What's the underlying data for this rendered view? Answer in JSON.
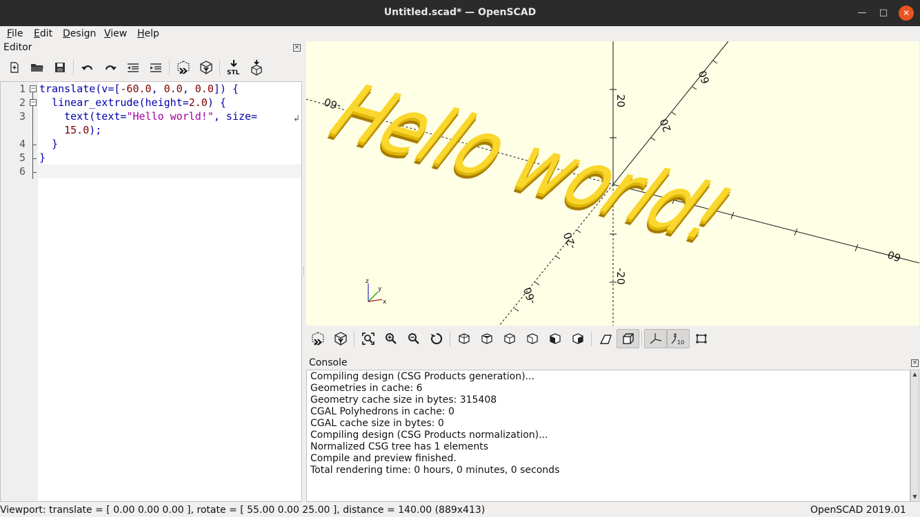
{
  "window": {
    "title": "Untitled.scad* — OpenSCAD"
  },
  "menu": {
    "items": [
      {
        "label": "File",
        "mnemonic": "F",
        "rest": "ile"
      },
      {
        "label": "Edit",
        "mnemonic": "E",
        "rest": "dit"
      },
      {
        "label": "Design",
        "mnemonic": "D",
        "rest": "esign"
      },
      {
        "label": "View",
        "mnemonic": "V",
        "rest": "iew"
      },
      {
        "label": "Help",
        "mnemonic": "H",
        "rest": "elp"
      }
    ]
  },
  "editor": {
    "title": "Editor",
    "toolbar": [
      "new-file-icon",
      "open-file-icon",
      "save-icon",
      "undo-icon",
      "redo-icon",
      "unindent-icon",
      "indent-icon",
      "preview-icon",
      "render-icon",
      "export-stl-icon",
      "send-to-print-icon"
    ],
    "lines": [
      {
        "num": "1",
        "parts": [
          {
            "t": "translate(v=[",
            "c": "kw"
          },
          {
            "t": "-60.0",
            "c": "num"
          },
          {
            "t": ", ",
            "c": "kw"
          },
          {
            "t": "0.0",
            "c": "num"
          },
          {
            "t": ", ",
            "c": "kw"
          },
          {
            "t": "0.0",
            "c": "num"
          },
          {
            "t": "]) {",
            "c": "kw"
          }
        ]
      },
      {
        "num": "2",
        "parts": [
          {
            "t": "  linear_extrude(height=",
            "c": "kw"
          },
          {
            "t": "2.0",
            "c": "num"
          },
          {
            "t": ") {",
            "c": "kw"
          }
        ]
      },
      {
        "num": "3",
        "parts": [
          {
            "t": "    text(text=",
            "c": "kw"
          },
          {
            "t": "\"Hello world!\"",
            "c": "str"
          },
          {
            "t": ", size=",
            "c": "kw"
          }
        ]
      },
      {
        "num": "",
        "parts": [
          {
            "t": "    ",
            "c": "kw"
          },
          {
            "t": "15.0",
            "c": "num"
          },
          {
            "t": ");",
            "c": "kw"
          }
        ]
      },
      {
        "num": "4",
        "parts": [
          {
            "t": "  }",
            "c": "kw"
          }
        ]
      },
      {
        "num": "5",
        "parts": [
          {
            "t": "}",
            "c": "kw"
          }
        ]
      },
      {
        "num": "6",
        "parts": []
      }
    ]
  },
  "viewport": {
    "text": "Hello world!",
    "axis_labels": {
      "x_neg": "-60",
      "x_pos": "60",
      "y_top": "60",
      "y_mid": "20",
      "z_pos": "20",
      "z_neg": "-20",
      "y_neg_a": "-20",
      "y_neg_b": "-60"
    },
    "axes_indicator": {
      "x": "x",
      "y": "y",
      "z": "z"
    },
    "colors": {
      "background": "#ffffe5",
      "model_top": "#f9d72c",
      "model_side": "#e0b50a",
      "model_dark": "#a77d00"
    },
    "toolbar": [
      "preview-icon",
      "render-icon",
      "view-all-icon",
      "zoom-in-icon",
      "zoom-out-icon",
      "reset-view-icon",
      "view-right-icon",
      "view-top-icon",
      "view-bottom-icon",
      "view-left-icon",
      "view-front-icon",
      "view-back-icon",
      "perspective-icon",
      "orthogonal-icon",
      "show-axes-icon",
      "show-scale-markers-icon",
      "show-edges-icon"
    ]
  },
  "console": {
    "title": "Console",
    "lines": [
      "Compiling design (CSG Products generation)...",
      "Geometries in cache: 6",
      "Geometry cache size in bytes: 315408",
      "CGAL Polyhedrons in cache: 0",
      "CGAL cache size in bytes: 0",
      "Compiling design (CSG Products normalization)...",
      "Normalized CSG tree has 1 elements",
      "Compile and preview finished.",
      "Total rendering time: 0 hours, 0 minutes, 0 seconds"
    ]
  },
  "statusbar": {
    "viewport": "Viewport: translate = [ 0.00 0.00 0.00 ], rotate = [ 55.00 0.00 25.00 ], distance = 140.00 (889x413)",
    "version": "OpenSCAD 2019.01"
  }
}
